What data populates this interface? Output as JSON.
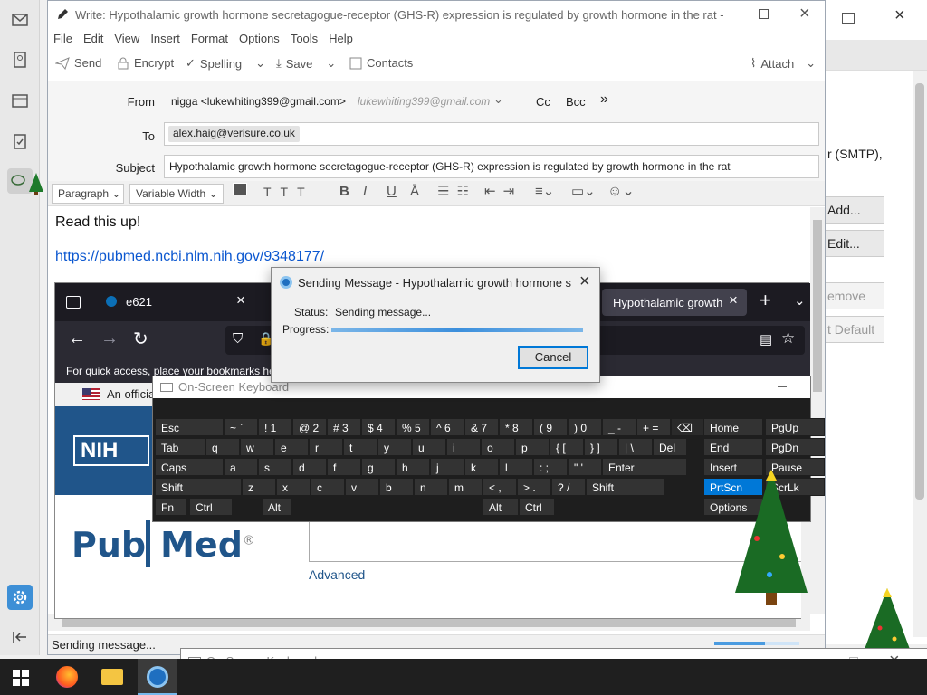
{
  "compose": {
    "title": "Write: Hypothalamic growth hormone secretagogue-receptor (GHS-R) expression is regulated by growth hormone in the rat - Th...",
    "menu": [
      "File",
      "Edit",
      "View",
      "Insert",
      "Format",
      "Options",
      "Tools",
      "Help"
    ],
    "toolbar": {
      "send": "Send",
      "encrypt": "Encrypt",
      "spelling": "Spelling",
      "save": "Save",
      "contacts": "Contacts",
      "attach": "Attach"
    },
    "from_label": "From",
    "from_value": "nigga <lukewhiting399@gmail.com>",
    "from_hint": "lukewhiting399@gmail.com",
    "cc": "Cc",
    "bcc": "Bcc",
    "to_label": "To",
    "to_value": "alex.haig@verisure.co.uk",
    "subject_label": "Subject",
    "subject_value": "Hypothalamic growth hormone secretagogue-receptor (GHS-R) expression is regulated by growth hormone in the rat",
    "format": {
      "paragraph": "Paragraph",
      "font": "Variable Width"
    },
    "body_line1": "Read this up!",
    "body_link": "https://pubmed.ncbi.nlm.nih.gov/9348177/",
    "status": "Sending message..."
  },
  "settings_bg": {
    "fragment": "r (SMTP),",
    "add": "Add...",
    "edit": "Edit...",
    "remove": "emove",
    "default": "t Default"
  },
  "dialog": {
    "title": "Sending Message - Hypothalamic growth hormone sec...",
    "status_label": "Status:",
    "status_value": "Sending message...",
    "progress_label": "Progress:",
    "cancel": "Cancel"
  },
  "firefox": {
    "tab1": "e621",
    "tab2": "Hypothalamic growth h",
    "bookmarks_text": "For quick access, place your bookmarks her",
    "gov_text": "An officia",
    "nih": "NIH",
    "pubmed_a": "Pub",
    "pubmed_b": "Med",
    "registered": "®",
    "advanced": "Advanced"
  },
  "osk": {
    "title": "On-Screen Keyboard",
    "row1": [
      "Esc",
      "~ `",
      "! 1",
      "@ 2",
      "# 3",
      "$ 4",
      "% 5",
      "^ 6",
      "& 7",
      "* 8",
      "( 9",
      ") 0",
      "_ -",
      "+ ="
    ],
    "row2": [
      "Tab",
      "q",
      "w",
      "e",
      "r",
      "t",
      "y",
      "u",
      "i",
      "o",
      "p",
      "{ [",
      "} ]",
      "| \\",
      "Del"
    ],
    "row3": [
      "Caps",
      "a",
      "s",
      "d",
      "f",
      "g",
      "h",
      "j",
      "k",
      "l",
      ": ;",
      "\" '",
      "Enter"
    ],
    "row4": [
      "Shift",
      "z",
      "x",
      "c",
      "v",
      "b",
      "n",
      "m",
      "< ,",
      "> .",
      "? /",
      "Shift"
    ],
    "row5": [
      "Fn",
      "Ctrl",
      "Alt",
      "Alt",
      "Ctrl"
    ],
    "nav": [
      "Home",
      "PgUp",
      "End",
      "PgDn",
      "Insert",
      "Pause",
      "PrtScn",
      "ScrLk",
      "Options"
    ]
  },
  "osk2": {
    "title": "On-Screen Keyboard"
  },
  "colors": {
    "accent": "#0078d7",
    "link": "#0b57d0",
    "nih": "#20558a",
    "pubmed": "#20558a"
  }
}
